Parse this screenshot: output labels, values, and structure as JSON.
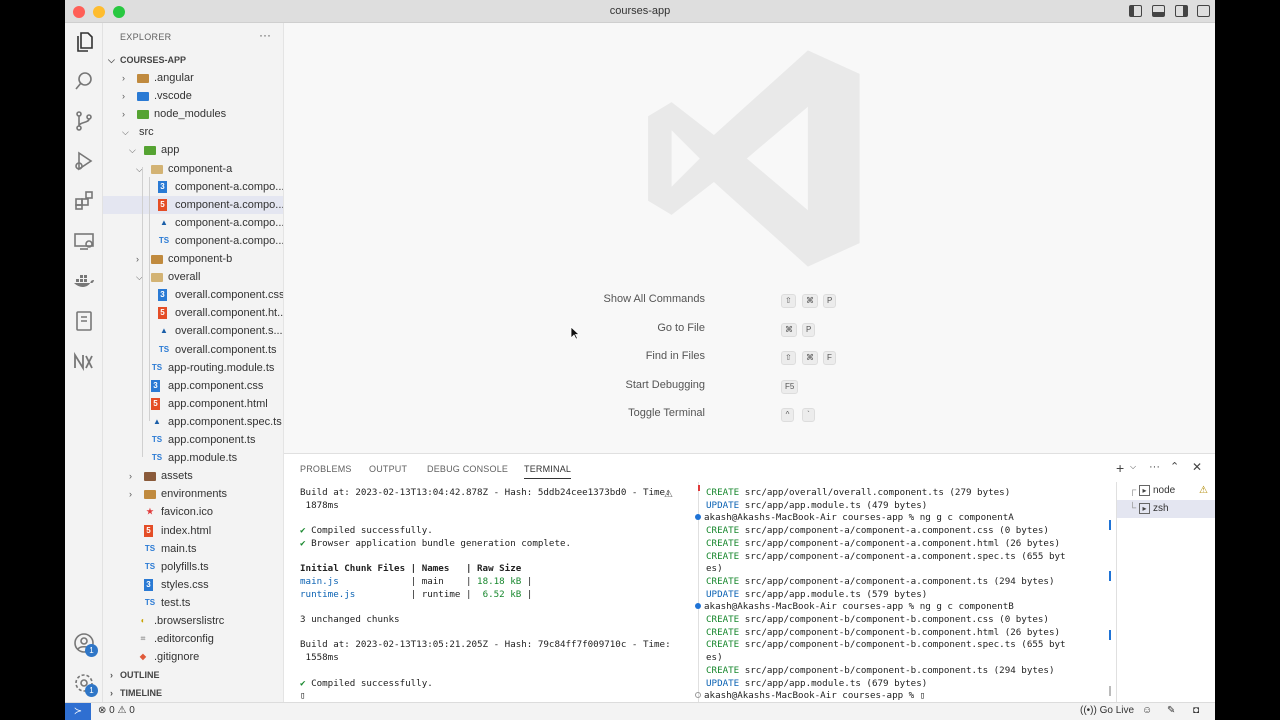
{
  "window": {
    "title": "courses-app"
  },
  "sidebar": {
    "header": "EXPLORER",
    "more": "···",
    "root": "COURSES-APP",
    "tree": [
      {
        "label": ".angular",
        "depth": 1,
        "kind": "folder",
        "open": false,
        "color": "#c08a3e"
      },
      {
        "label": ".vscode",
        "depth": 1,
        "kind": "folder",
        "open": false,
        "color": "#2a7ad4"
      },
      {
        "label": "node_modules",
        "depth": 1,
        "kind": "folder",
        "open": false,
        "color": "#55a332"
      },
      {
        "label": "src",
        "depth": 1,
        "kind": "folder",
        "open": true,
        "color": ""
      },
      {
        "label": "app",
        "depth": 2,
        "kind": "folder",
        "open": true,
        "color": "#55a332"
      },
      {
        "label": "component-a",
        "depth": 3,
        "kind": "folder",
        "open": true,
        "color": "#d3b374"
      },
      {
        "label": "component-a.compo...",
        "depth": 4,
        "kind": "css"
      },
      {
        "label": "component-a.compo...",
        "depth": 4,
        "kind": "html",
        "selected": true
      },
      {
        "label": "component-a.compo...",
        "depth": 4,
        "kind": "spec"
      },
      {
        "label": "component-a.compo...",
        "depth": 4,
        "kind": "ts"
      },
      {
        "label": "component-b",
        "depth": 3,
        "kind": "folder",
        "open": false,
        "color": "#c08a3e"
      },
      {
        "label": "overall",
        "depth": 3,
        "kind": "folder",
        "open": true,
        "color": "#d3b374"
      },
      {
        "label": "overall.component.css",
        "depth": 4,
        "kind": "css"
      },
      {
        "label": "overall.component.ht...",
        "depth": 4,
        "kind": "html"
      },
      {
        "label": "overall.component.s...",
        "depth": 4,
        "kind": "spec"
      },
      {
        "label": "overall.component.ts",
        "depth": 4,
        "kind": "ts"
      },
      {
        "label": "app-routing.module.ts",
        "depth": 3,
        "kind": "ts"
      },
      {
        "label": "app.component.css",
        "depth": 3,
        "kind": "css"
      },
      {
        "label": "app.component.html",
        "depth": 3,
        "kind": "html"
      },
      {
        "label": "app.component.spec.ts",
        "depth": 3,
        "kind": "spec"
      },
      {
        "label": "app.component.ts",
        "depth": 3,
        "kind": "ts"
      },
      {
        "label": "app.module.ts",
        "depth": 3,
        "kind": "ts"
      },
      {
        "label": "assets",
        "depth": 2,
        "kind": "folder",
        "open": false,
        "color": "#8a5a3a"
      },
      {
        "label": "environments",
        "depth": 2,
        "kind": "folder",
        "open": false,
        "color": "#c08a3e"
      },
      {
        "label": "favicon.ico",
        "depth": 2,
        "kind": "ico"
      },
      {
        "label": "index.html",
        "depth": 2,
        "kind": "html"
      },
      {
        "label": "main.ts",
        "depth": 2,
        "kind": "ts"
      },
      {
        "label": "polyfills.ts",
        "depth": 2,
        "kind": "ts"
      },
      {
        "label": "styles.css",
        "depth": 2,
        "kind": "css"
      },
      {
        "label": "test.ts",
        "depth": 2,
        "kind": "ts"
      },
      {
        "label": ".browserslistrc",
        "depth": 1,
        "kind": "browsers"
      },
      {
        "label": ".editorconfig",
        "depth": 1,
        "kind": "config"
      },
      {
        "label": ".gitignore",
        "depth": 1,
        "kind": "git"
      }
    ],
    "outline": "OUTLINE",
    "timeline": "TIMELINE"
  },
  "welcome": {
    "shortcuts": [
      {
        "label": "Show All Commands",
        "keys": [
          "⇧",
          "⌘",
          "P"
        ]
      },
      {
        "label": "Go to File",
        "keys": [
          "⌘",
          "P"
        ]
      },
      {
        "label": "Find in Files",
        "keys": [
          "⇧",
          "⌘",
          "F"
        ]
      },
      {
        "label": "Start Debugging",
        "keys": [
          "F5"
        ]
      },
      {
        "label": "Toggle Terminal",
        "keys": [
          "^",
          "`"
        ]
      }
    ]
  },
  "panel": {
    "tabs": [
      "PROBLEMS",
      "OUTPUT",
      "DEBUG CONSOLE",
      "TERMINAL"
    ],
    "active_tab": "TERMINAL",
    "left_terminal": [
      {
        "t": "Build at: 2023-02-13T13:04:42.878Z - Hash: 5ddb24cee1373bd0 - Time:"
      },
      {
        "t": " 1878ms"
      },
      {
        "t": ""
      },
      {
        "t": "✔ Compiled successfully.",
        "check": true
      },
      {
        "t": "✔ Browser application bundle generation complete.",
        "check": true
      },
      {
        "t": ""
      },
      {
        "t": "Initial Chunk Files | Names   | Raw Size",
        "bold": true
      },
      {
        "t": "main.js             | main    | 18.18 kB |",
        "color": true
      },
      {
        "t": "runtime.js          | runtime |  6.52 kB |",
        "color": true
      },
      {
        "t": ""
      },
      {
        "t": "3 unchanged chunks"
      },
      {
        "t": ""
      },
      {
        "t": "Build at: 2023-02-13T13:05:21.205Z - Hash: 79c84ff7f009710c - Time:"
      },
      {
        "t": " 1558ms"
      },
      {
        "t": ""
      },
      {
        "t": "✔ Compiled successfully.",
        "check": true
      },
      {
        "t": "▯"
      }
    ],
    "right_terminal": [
      {
        "t": "CREATE src/app/overall/overall.component.ts (279 bytes)"
      },
      {
        "t": "UPDATE src/app/app.module.ts (479 bytes)"
      },
      {
        "t": "akash@Akashs-MacBook-Air courses-app % ng g c componentA",
        "prompt": "filled"
      },
      {
        "t": "CREATE src/app/component-a/component-a.component.css (0 bytes)"
      },
      {
        "t": "CREATE src/app/component-a/component-a.component.html (26 bytes)"
      },
      {
        "t": "CREATE src/app/component-a/component-a.component.spec.ts (655 byt"
      },
      {
        "t": "es)"
      },
      {
        "t": "CREATE src/app/component-a/component-a.component.ts (294 bytes)"
      },
      {
        "t": "UPDATE src/app/app.module.ts (579 bytes)"
      },
      {
        "t": "akash@Akashs-MacBook-Air courses-app % ng g c componentB",
        "prompt": "filled"
      },
      {
        "t": "CREATE src/app/component-b/component-b.component.css (0 bytes)"
      },
      {
        "t": "CREATE src/app/component-b/component-b.component.html (26 bytes)"
      },
      {
        "t": "CREATE src/app/component-b/component-b.component.spec.ts (655 byt"
      },
      {
        "t": "es)"
      },
      {
        "t": "CREATE src/app/component-b/component-b.component.ts (294 bytes)"
      },
      {
        "t": "UPDATE src/app/app.module.ts (679 bytes)"
      },
      {
        "t": "akash@Akashs-MacBook-Air courses-app % ▯",
        "prompt": "open"
      }
    ],
    "terminals": [
      {
        "label": "node",
        "warn": true
      },
      {
        "label": "zsh",
        "selected": true
      }
    ]
  },
  "status": {
    "problems": "0",
    "warnings": "0",
    "go_live": "Go Live"
  },
  "colors": {
    "accent": "#2f6fd1",
    "ts": "#2a7ad4",
    "html": "#e44d26",
    "create": "#17872d",
    "update": "#0b62b3"
  }
}
